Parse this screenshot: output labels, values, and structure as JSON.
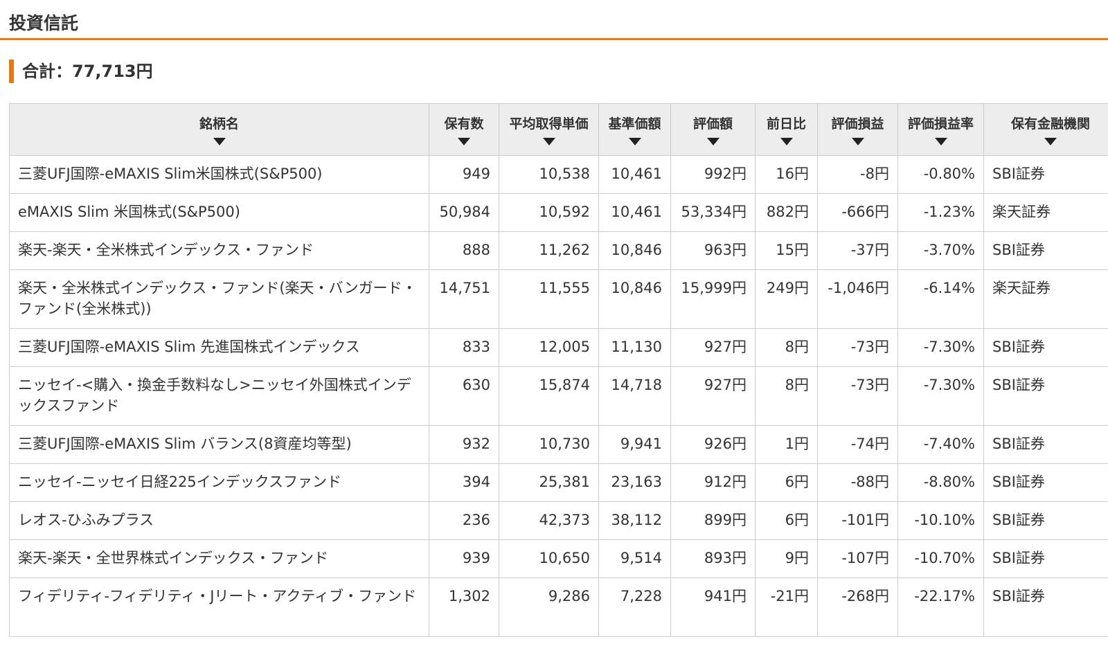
{
  "section": {
    "title": "投資信託"
  },
  "summary": {
    "total_label": "合計：",
    "total_value": "77,713円"
  },
  "colors": {
    "accent": "#ee7800",
    "positive": "#2a6db0",
    "negative": "#c8102e"
  },
  "columns": [
    "銘柄名",
    "保有数",
    "平均取得単価",
    "基準価額",
    "評価額",
    "前日比",
    "評価損益",
    "評価損益率",
    "保有金融機関"
  ],
  "rows": [
    {
      "name": "三菱UFJ国際-eMAXIS Slim米国株式(S&P500)",
      "qty": "949",
      "avg": "10,538",
      "base": "10,461",
      "value": "992円",
      "dod": "16円",
      "pl": "-8円",
      "rate": "-0.80%",
      "inst": "SBI証券",
      "dod_sign": "pos"
    },
    {
      "name": "eMAXIS Slim 米国株式(S&P500)",
      "qty": "50,984",
      "avg": "10,592",
      "base": "10,461",
      "value": "53,334円",
      "dod": "882円",
      "pl": "-666円",
      "rate": "-1.23%",
      "inst": "楽天証券",
      "dod_sign": "pos"
    },
    {
      "name": "楽天-楽天・全米株式インデックス・ファンド",
      "qty": "888",
      "avg": "11,262",
      "base": "10,846",
      "value": "963円",
      "dod": "15円",
      "pl": "-37円",
      "rate": "-3.70%",
      "inst": "SBI証券",
      "dod_sign": "pos"
    },
    {
      "name": "楽天・全米株式インデックス・ファンド(楽天・バンガード・ファンド(全米株式))",
      "qty": "14,751",
      "avg": "11,555",
      "base": "10,846",
      "value": "15,999円",
      "dod": "249円",
      "pl": "-1,046円",
      "rate": "-6.14%",
      "inst": "楽天証券",
      "dod_sign": "pos"
    },
    {
      "name": "三菱UFJ国際-eMAXIS Slim 先進国株式インデックス",
      "qty": "833",
      "avg": "12,005",
      "base": "11,130",
      "value": "927円",
      "dod": "8円",
      "pl": "-73円",
      "rate": "-7.30%",
      "inst": "SBI証券",
      "dod_sign": "pos"
    },
    {
      "name": "ニッセイ-<購入・換金手数料なし>ニッセイ外国株式インデックスファンド",
      "qty": "630",
      "avg": "15,874",
      "base": "14,718",
      "value": "927円",
      "dod": "8円",
      "pl": "-73円",
      "rate": "-7.30%",
      "inst": "SBI証券",
      "dod_sign": "pos"
    },
    {
      "name": "三菱UFJ国際-eMAXIS Slim バランス(8資産均等型)",
      "qty": "932",
      "avg": "10,730",
      "base": "9,941",
      "value": "926円",
      "dod": "1円",
      "pl": "-74円",
      "rate": "-7.40%",
      "inst": "SBI証券",
      "dod_sign": "pos"
    },
    {
      "name": "ニッセイ-ニッセイ日経225インデックスファンド",
      "qty": "394",
      "avg": "25,381",
      "base": "23,163",
      "value": "912円",
      "dod": "6円",
      "pl": "-88円",
      "rate": "-8.80%",
      "inst": "SBI証券",
      "dod_sign": "pos"
    },
    {
      "name": "レオス-ひふみプラス",
      "qty": "236",
      "avg": "42,373",
      "base": "38,112",
      "value": "899円",
      "dod": "6円",
      "pl": "-101円",
      "rate": "-10.10%",
      "inst": "SBI証券",
      "dod_sign": "pos"
    },
    {
      "name": "楽天-楽天・全世界株式インデックス・ファンド",
      "qty": "939",
      "avg": "10,650",
      "base": "9,514",
      "value": "893円",
      "dod": "9円",
      "pl": "-107円",
      "rate": "-10.70%",
      "inst": "SBI証券",
      "dod_sign": "pos"
    },
    {
      "name": "フィデリティ-フィデリティ・Jリート・アクティブ・ファンド",
      "qty": "1,302",
      "avg": "9,286",
      "base": "7,228",
      "value": "941円",
      "dod": "-21円",
      "pl": "-268円",
      "rate": "-22.17%",
      "inst": "SBI証券",
      "dod_sign": "neg"
    }
  ]
}
